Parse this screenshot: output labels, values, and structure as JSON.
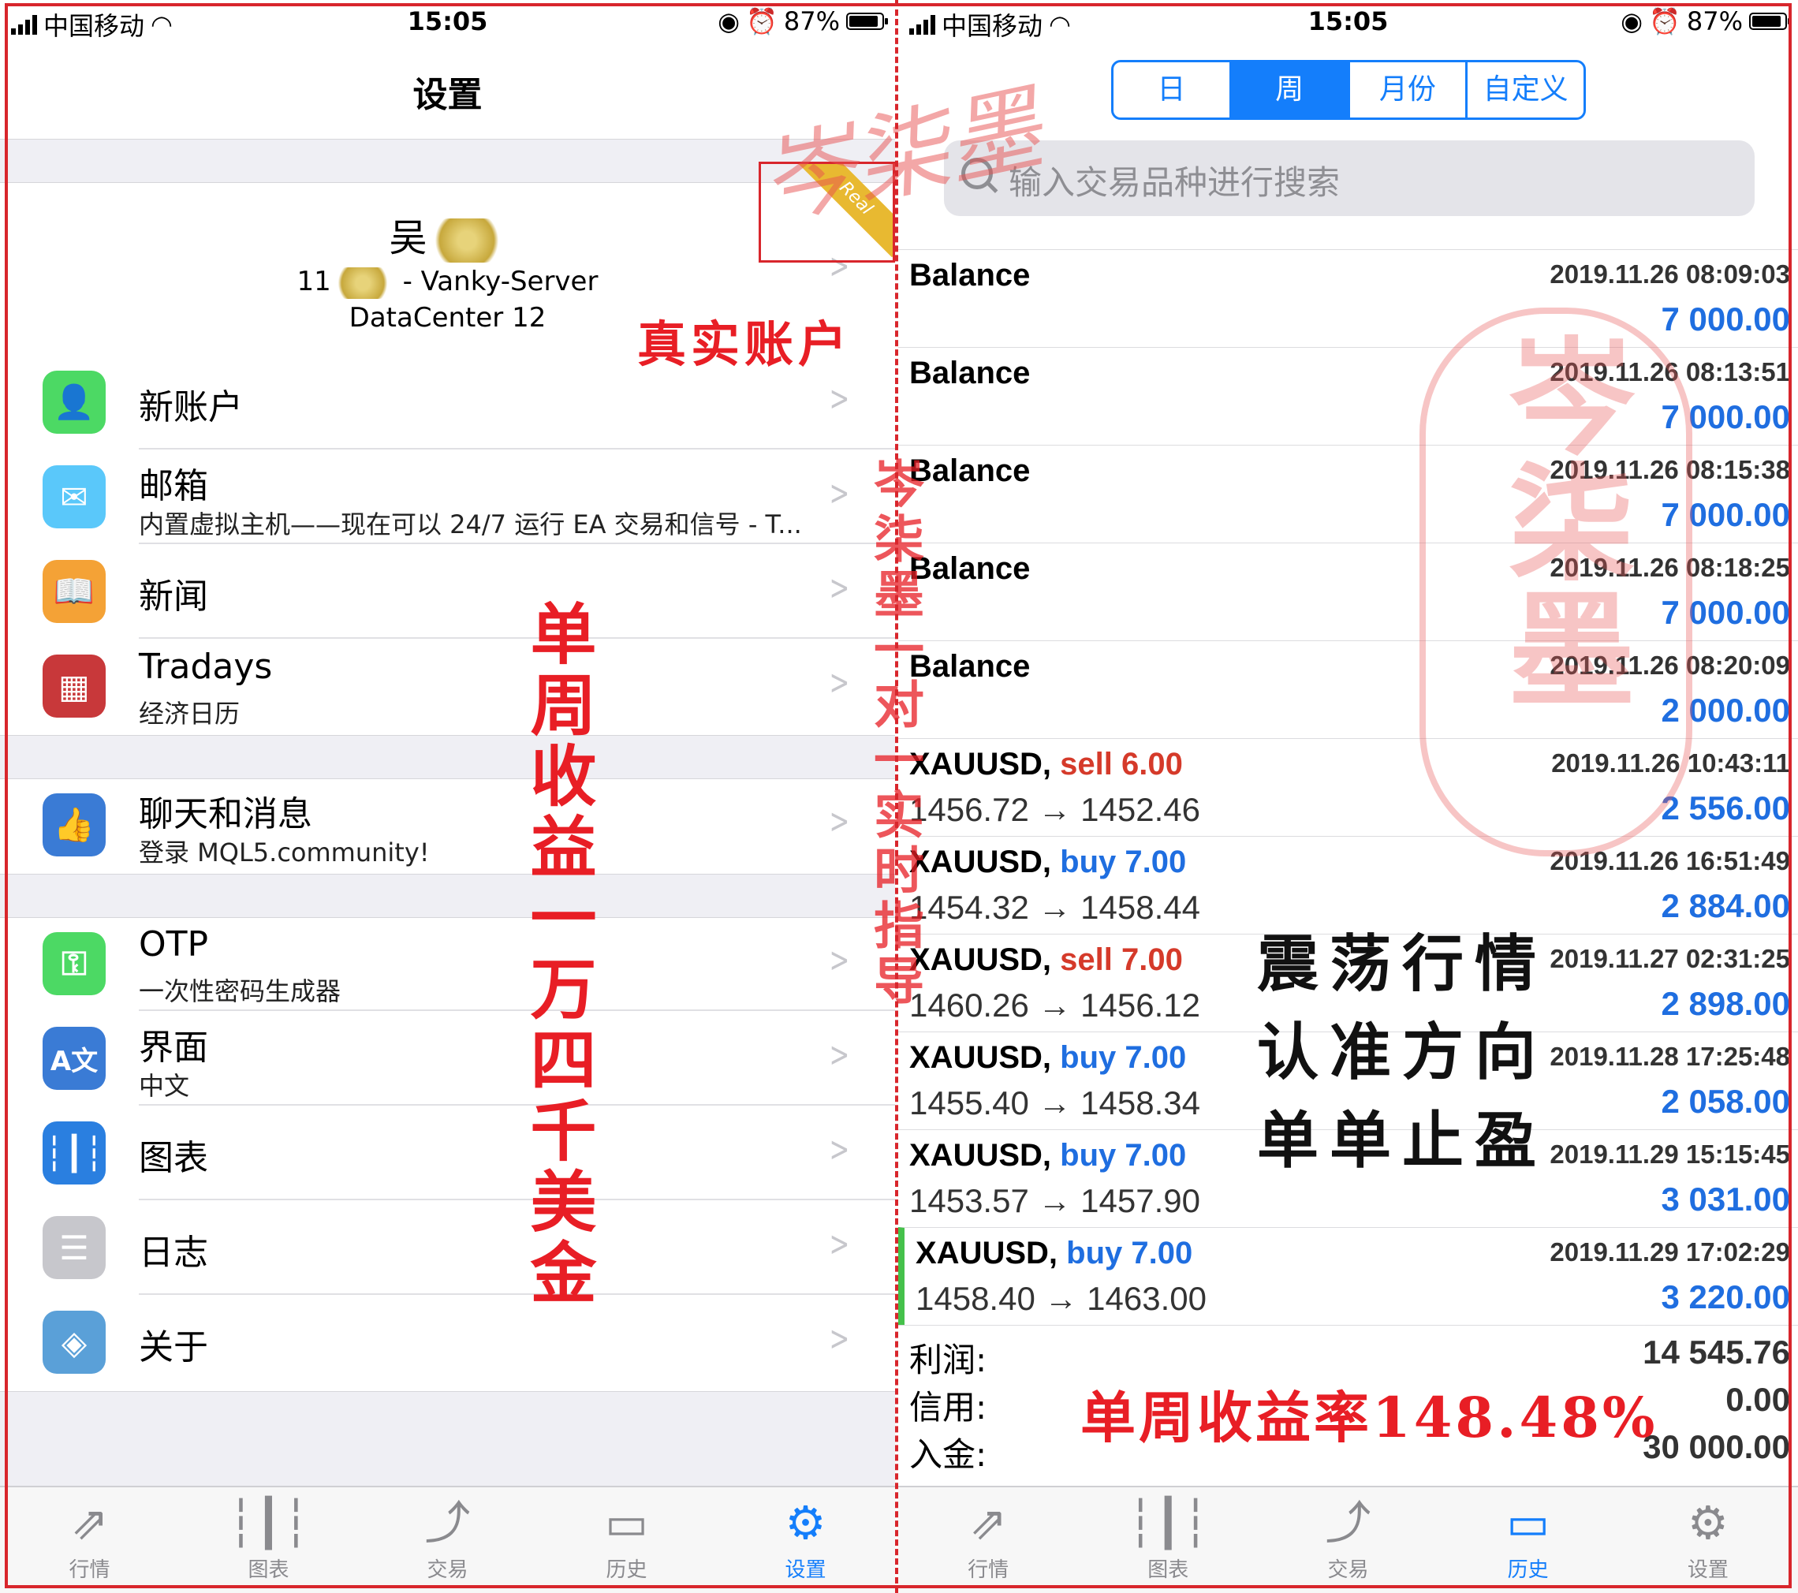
{
  "status": {
    "carrier": "中国移动",
    "time": "15:05",
    "battery": "87%"
  },
  "settings": {
    "title": "设置",
    "account": {
      "name": "吴",
      "line1_prefix": "11",
      "line1_suffix": "- Vanky-Server",
      "line2": "DataCenter 12",
      "badge": "Real"
    },
    "rows": [
      {
        "title": "新账户",
        "subtitle": "",
        "icon": "add-user-icon",
        "color": "#4cd964"
      },
      {
        "title": "邮箱",
        "subtitle": "内置虚拟主机——现在可以 24/7 运行 EA 交易和信号 - T...",
        "icon": "mail-icon",
        "color": "#5ac8fa"
      },
      {
        "title": "新闻",
        "subtitle": "",
        "icon": "book-icon",
        "color": "#f4a236"
      },
      {
        "title": "Tradays",
        "subtitle": "经济日历",
        "icon": "calendar-icon",
        "color": "#c8383a"
      },
      {
        "title": "聊天和消息",
        "subtitle": "登录 MQL5.community!",
        "icon": "chat-icon",
        "color": "#3a7bd5"
      },
      {
        "title": "OTP",
        "subtitle": "一次性密码生成器",
        "icon": "key-icon",
        "color": "#4cd964"
      },
      {
        "title": "界面",
        "subtitle": "中文",
        "icon": "language-icon",
        "color": "#3a7bd5"
      },
      {
        "title": "图表",
        "subtitle": "",
        "icon": "chart-icon",
        "color": "#2a7fe0"
      },
      {
        "title": "日志",
        "subtitle": "",
        "icon": "log-icon",
        "color": "#c7c7cc"
      },
      {
        "title": "关于",
        "subtitle": "",
        "icon": "about-icon",
        "color": "#5aa0d8"
      }
    ]
  },
  "tabs": [
    "行情",
    "图表",
    "交易",
    "历史",
    "设置"
  ],
  "history": {
    "periods": [
      "日",
      "周",
      "月份",
      "自定义"
    ],
    "active_period": "周",
    "search_placeholder": "输入交易品种进行搜索",
    "deals": [
      {
        "symbol": "Balance",
        "side": "",
        "volume": "",
        "prices": "",
        "time": "2019.11.26 08:09:03",
        "amount": "7 000.00"
      },
      {
        "symbol": "Balance",
        "side": "",
        "volume": "",
        "prices": "",
        "time": "2019.11.26 08:13:51",
        "amount": "7 000.00"
      },
      {
        "symbol": "Balance",
        "side": "",
        "volume": "",
        "prices": "",
        "time": "2019.11.26 08:15:38",
        "amount": "7 000.00"
      },
      {
        "symbol": "Balance",
        "side": "",
        "volume": "",
        "prices": "",
        "time": "2019.11.26 08:18:25",
        "amount": "7 000.00"
      },
      {
        "symbol": "Balance",
        "side": "",
        "volume": "",
        "prices": "",
        "time": "2019.11.26 08:20:09",
        "amount": "2 000.00"
      },
      {
        "symbol": "XAUUSD,",
        "side": "sell",
        "volume": "6.00",
        "prices": "1456.72 → 1452.46",
        "time": "2019.11.26 10:43:11",
        "amount": "2 556.00"
      },
      {
        "symbol": "XAUUSD,",
        "side": "buy",
        "volume": "7.00",
        "prices": "1454.32 → 1458.44",
        "time": "2019.11.26 16:51:49",
        "amount": "2 884.00"
      },
      {
        "symbol": "XAUUSD,",
        "side": "sell",
        "volume": "7.00",
        "prices": "1460.26 → 1456.12",
        "time": "2019.11.27 02:31:25",
        "amount": "2 898.00"
      },
      {
        "symbol": "XAUUSD,",
        "side": "buy",
        "volume": "7.00",
        "prices": "1455.40 → 1458.34",
        "time": "2019.11.28 17:25:48",
        "amount": "2 058.00"
      },
      {
        "symbol": "XAUUSD,",
        "side": "buy",
        "volume": "7.00",
        "prices": "1453.57 → 1457.90",
        "time": "2019.11.29 15:15:45",
        "amount": "3 031.00"
      },
      {
        "symbol": "XAUUSD,",
        "side": "buy",
        "volume": "7.00",
        "prices": "1458.40 → 1463.00",
        "time": "2019.11.29 17:02:29",
        "amount": "3 220.00"
      }
    ],
    "summary": [
      {
        "label": "利润:",
        "value": "14 545.76"
      },
      {
        "label": "信用:",
        "value": "0.00"
      },
      {
        "label": "入金:",
        "value": "30 000.00"
      }
    ]
  },
  "annotations": {
    "real_account": "真实账户",
    "weekly_profit": "单周收益一万四千美金",
    "mentor": "岑柒墨一对一实时指导",
    "market1": "震荡行情",
    "market2": "认准方向",
    "market3": "单单止盈",
    "rate": "单周收益率148.48%",
    "seal": "岑柒墨",
    "signature": "岑柒墨"
  },
  "colors": {
    "accent": "#147efb",
    "annotation_red": "#e81e25",
    "buy": "#1f6ee0",
    "sell": "#d53a2a"
  }
}
